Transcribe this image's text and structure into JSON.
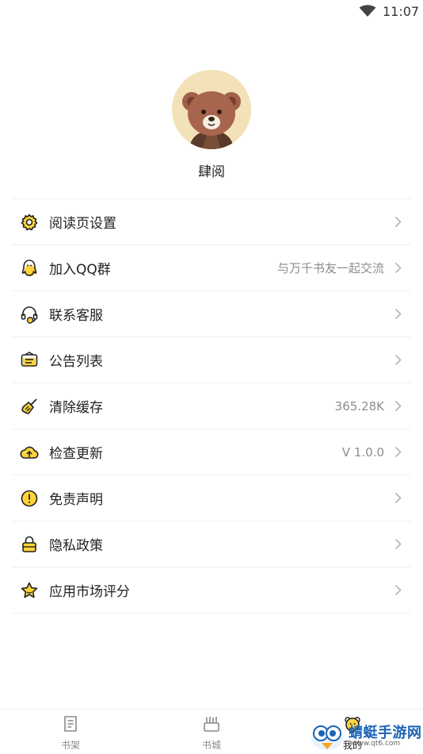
{
  "status_bar": {
    "time": "11:07"
  },
  "profile": {
    "nickname": "肆阅"
  },
  "menu": {
    "items": [
      {
        "label": "阅读页设置",
        "value": "",
        "icon": "gear-icon"
      },
      {
        "label": "加入QQ群",
        "value": "与万千书友一起交流",
        "icon": "qq-penguin-icon"
      },
      {
        "label": "联系客服",
        "value": "",
        "icon": "headset-icon"
      },
      {
        "label": "公告列表",
        "value": "",
        "icon": "announcement-icon"
      },
      {
        "label": "清除缓存",
        "value": "365.28K",
        "icon": "broom-icon"
      },
      {
        "label": "检查更新",
        "value": "V 1.0.0",
        "icon": "cloud-upload-icon"
      },
      {
        "label": "免责声明",
        "value": "",
        "icon": "exclamation-circle-icon"
      },
      {
        "label": "隐私政策",
        "value": "",
        "icon": "lock-icon"
      },
      {
        "label": "应用市场评分",
        "value": "",
        "icon": "star-icon"
      }
    ]
  },
  "tab_bar": {
    "tabs": [
      {
        "label": "书架",
        "icon": "bookshelf-icon"
      },
      {
        "label": "书城",
        "icon": "bookstore-icon"
      },
      {
        "label": "我的",
        "icon": "profile-icon"
      }
    ]
  },
  "watermark": {
    "title": "蜻蜓手游网",
    "url": "www.qt6.com"
  },
  "colors": {
    "accent": "#FFD43B",
    "icon_stroke": "#222222",
    "secondary_text": "#8D8D8D",
    "divider": "#EFEFEF"
  }
}
